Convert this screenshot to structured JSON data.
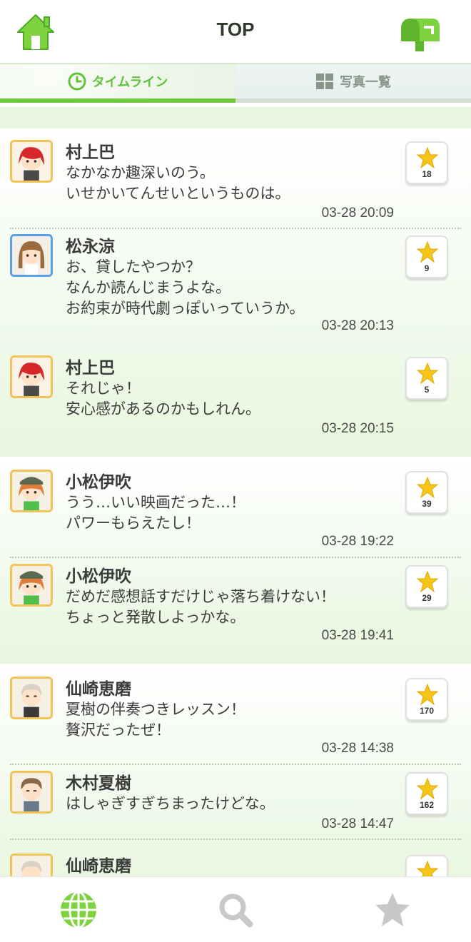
{
  "header": {
    "title": "TOP"
  },
  "tabs": [
    {
      "label": "タイムライン",
      "active": true
    },
    {
      "label": "写真一覧",
      "active": false
    }
  ],
  "posts": [
    {
      "name": "村上巴",
      "message": "なかなか趣深いのう。\nいせかいてんせいというものは。",
      "time": "03-28 20:09",
      "stars": "18",
      "avatar": "red-hair"
    },
    {
      "name": "松永涼",
      "message": "お、貸したやつか？\nなんか読んじまうよな。\nお約束が時代劇っぽいっていうか。",
      "time": "03-28 20:13",
      "stars": "9",
      "avatar": "brown-hair"
    },
    {
      "name": "村上巴",
      "message": "それじゃ！\n安心感があるのかもしれん。",
      "time": "03-28 20:15",
      "stars": "5",
      "avatar": "red-hair"
    },
    {
      "name": "小松伊吹",
      "message": "うう…いい映画だった…！\nパワーもらえたし！",
      "time": "03-28 19:22",
      "stars": "39",
      "avatar": "cap-girl"
    },
    {
      "name": "小松伊吹",
      "message": "だめだ感想話すだけじゃ落ち着けない！\nちょっと発散しよっかな。",
      "time": "03-28 19:41",
      "stars": "29",
      "avatar": "cap-girl"
    },
    {
      "name": "仙崎恵磨",
      "message": "夏樹の伴奏つきレッスン！\n贅沢だったぜ！",
      "time": "03-28 14:38",
      "stars": "170",
      "avatar": "silver-hair"
    },
    {
      "name": "木村夏樹",
      "message": "はしゃぎすぎちまったけどな。",
      "time": "03-28 14:47",
      "stars": "162",
      "avatar": "brown-short"
    },
    {
      "name": "仙崎恵磨",
      "message": "",
      "time": "",
      "stars": "",
      "avatar": "silver-hair"
    }
  ],
  "colors": {
    "accent_green": "#70c93b",
    "star_yellow": "#f5c518",
    "avatar_border_gold": "#f2c457",
    "avatar_border_blue": "#5aa0e8"
  },
  "icons": {
    "header_left": "home-icon",
    "header_right": "mailbox-icon",
    "tab_timeline": "clock-icon",
    "tab_photos": "grid-icon",
    "nav": [
      "globe-icon",
      "search-icon",
      "star-icon"
    ]
  }
}
